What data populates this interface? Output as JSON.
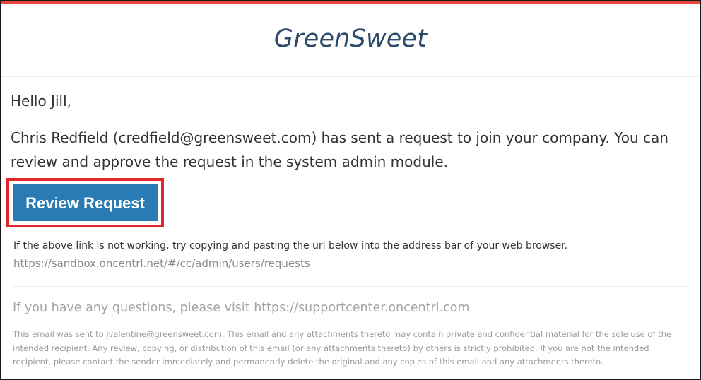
{
  "colors": {
    "accent_bar": "#e8453c",
    "brand_text": "#2d4a6b",
    "button_bg": "#2a7ab3",
    "highlight_border": "#e0262b"
  },
  "header": {
    "brand": "GreenSweet"
  },
  "email": {
    "greeting": "Hello Jill,",
    "message": "Chris Redfield (credfield@greensweet.com) has sent a request to join your company. You can review and approve the request in the system admin module.",
    "button_label": "Review Request",
    "fallback_text": "If the above link is not working, try copying and pasting the url below into the address bar of your web browser.",
    "fallback_url": "https://sandbox.oncentrl.net/#/cc/admin/users/requests",
    "questions": "If you have any questions, please visit https://supportcenter.oncentrl.com",
    "footer": "This email was sent to jvalentine@greensweet.com. This email and any attachments thereto may contain private and confidential material for the sole use of the intended recipient. Any review, copying, or distribution of this email (or any attachments thereto) by others is strictly prohibited. If you are not the intended recipient, please contact the sender immediately and permanently delete the original and any copies of this email and any attachments thereto."
  }
}
